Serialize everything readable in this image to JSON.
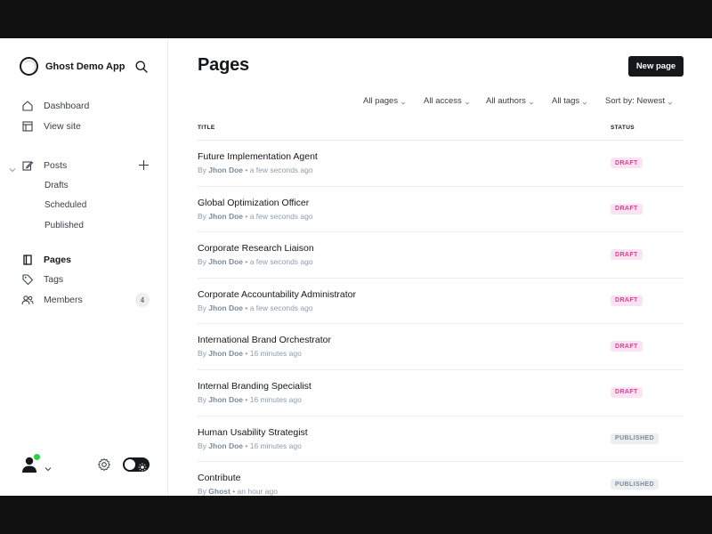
{
  "app": {
    "name": "Ghost Demo App"
  },
  "sidebar": {
    "nav_top": [
      {
        "label": "Dashboard",
        "icon": "home-icon"
      },
      {
        "label": "View site",
        "icon": "layout-icon"
      }
    ],
    "posts": {
      "label": "Posts",
      "icon": "edit-icon",
      "children": [
        "Drafts",
        "Scheduled",
        "Published"
      ]
    },
    "nav_bottom": [
      {
        "label": "Pages",
        "icon": "page-icon",
        "active": true
      },
      {
        "label": "Tags",
        "icon": "tag-icon"
      },
      {
        "label": "Members",
        "icon": "members-icon",
        "count": "4"
      }
    ]
  },
  "main": {
    "title": "Pages",
    "new_button": "New page",
    "filters": [
      "All pages",
      "All access",
      "All authors",
      "All tags",
      "Sort by: Newest"
    ],
    "columns": {
      "title": "TITLE",
      "status": "STATUS"
    },
    "rows": [
      {
        "title": "Future Implementation Agent",
        "author": "Jhon Doe",
        "time": "a few seconds ago",
        "status": "DRAFT"
      },
      {
        "title": "Global Optimization Officer",
        "author": "Jhon Doe",
        "time": "a few seconds ago",
        "status": "DRAFT"
      },
      {
        "title": "Corporate Research Liaison",
        "author": "Jhon Doe",
        "time": "a few seconds ago",
        "status": "DRAFT"
      },
      {
        "title": "Corporate Accountability Administrator",
        "author": "Jhon Doe",
        "time": "a few seconds ago",
        "status": "DRAFT"
      },
      {
        "title": "International Brand Orchestrator",
        "author": "Jhon Doe",
        "time": "16 minutes ago",
        "status": "DRAFT"
      },
      {
        "title": "Internal Branding Specialist",
        "author": "Jhon Doe",
        "time": "16 minutes ago",
        "status": "DRAFT"
      },
      {
        "title": "Human Usability Strategist",
        "author": "Jhon Doe",
        "time": "16 minutes ago",
        "status": "PUBLISHED"
      },
      {
        "title": "Contribute",
        "author": "Ghost",
        "time": "an hour ago",
        "status": "PUBLISHED"
      }
    ]
  },
  "colors": {
    "text": "#15171a",
    "muted": "#8e9cac",
    "draft_bg": "#fde3f1",
    "draft_text": "#e23b93",
    "published_bg": "#eceef0",
    "online": "#30cf43"
  }
}
